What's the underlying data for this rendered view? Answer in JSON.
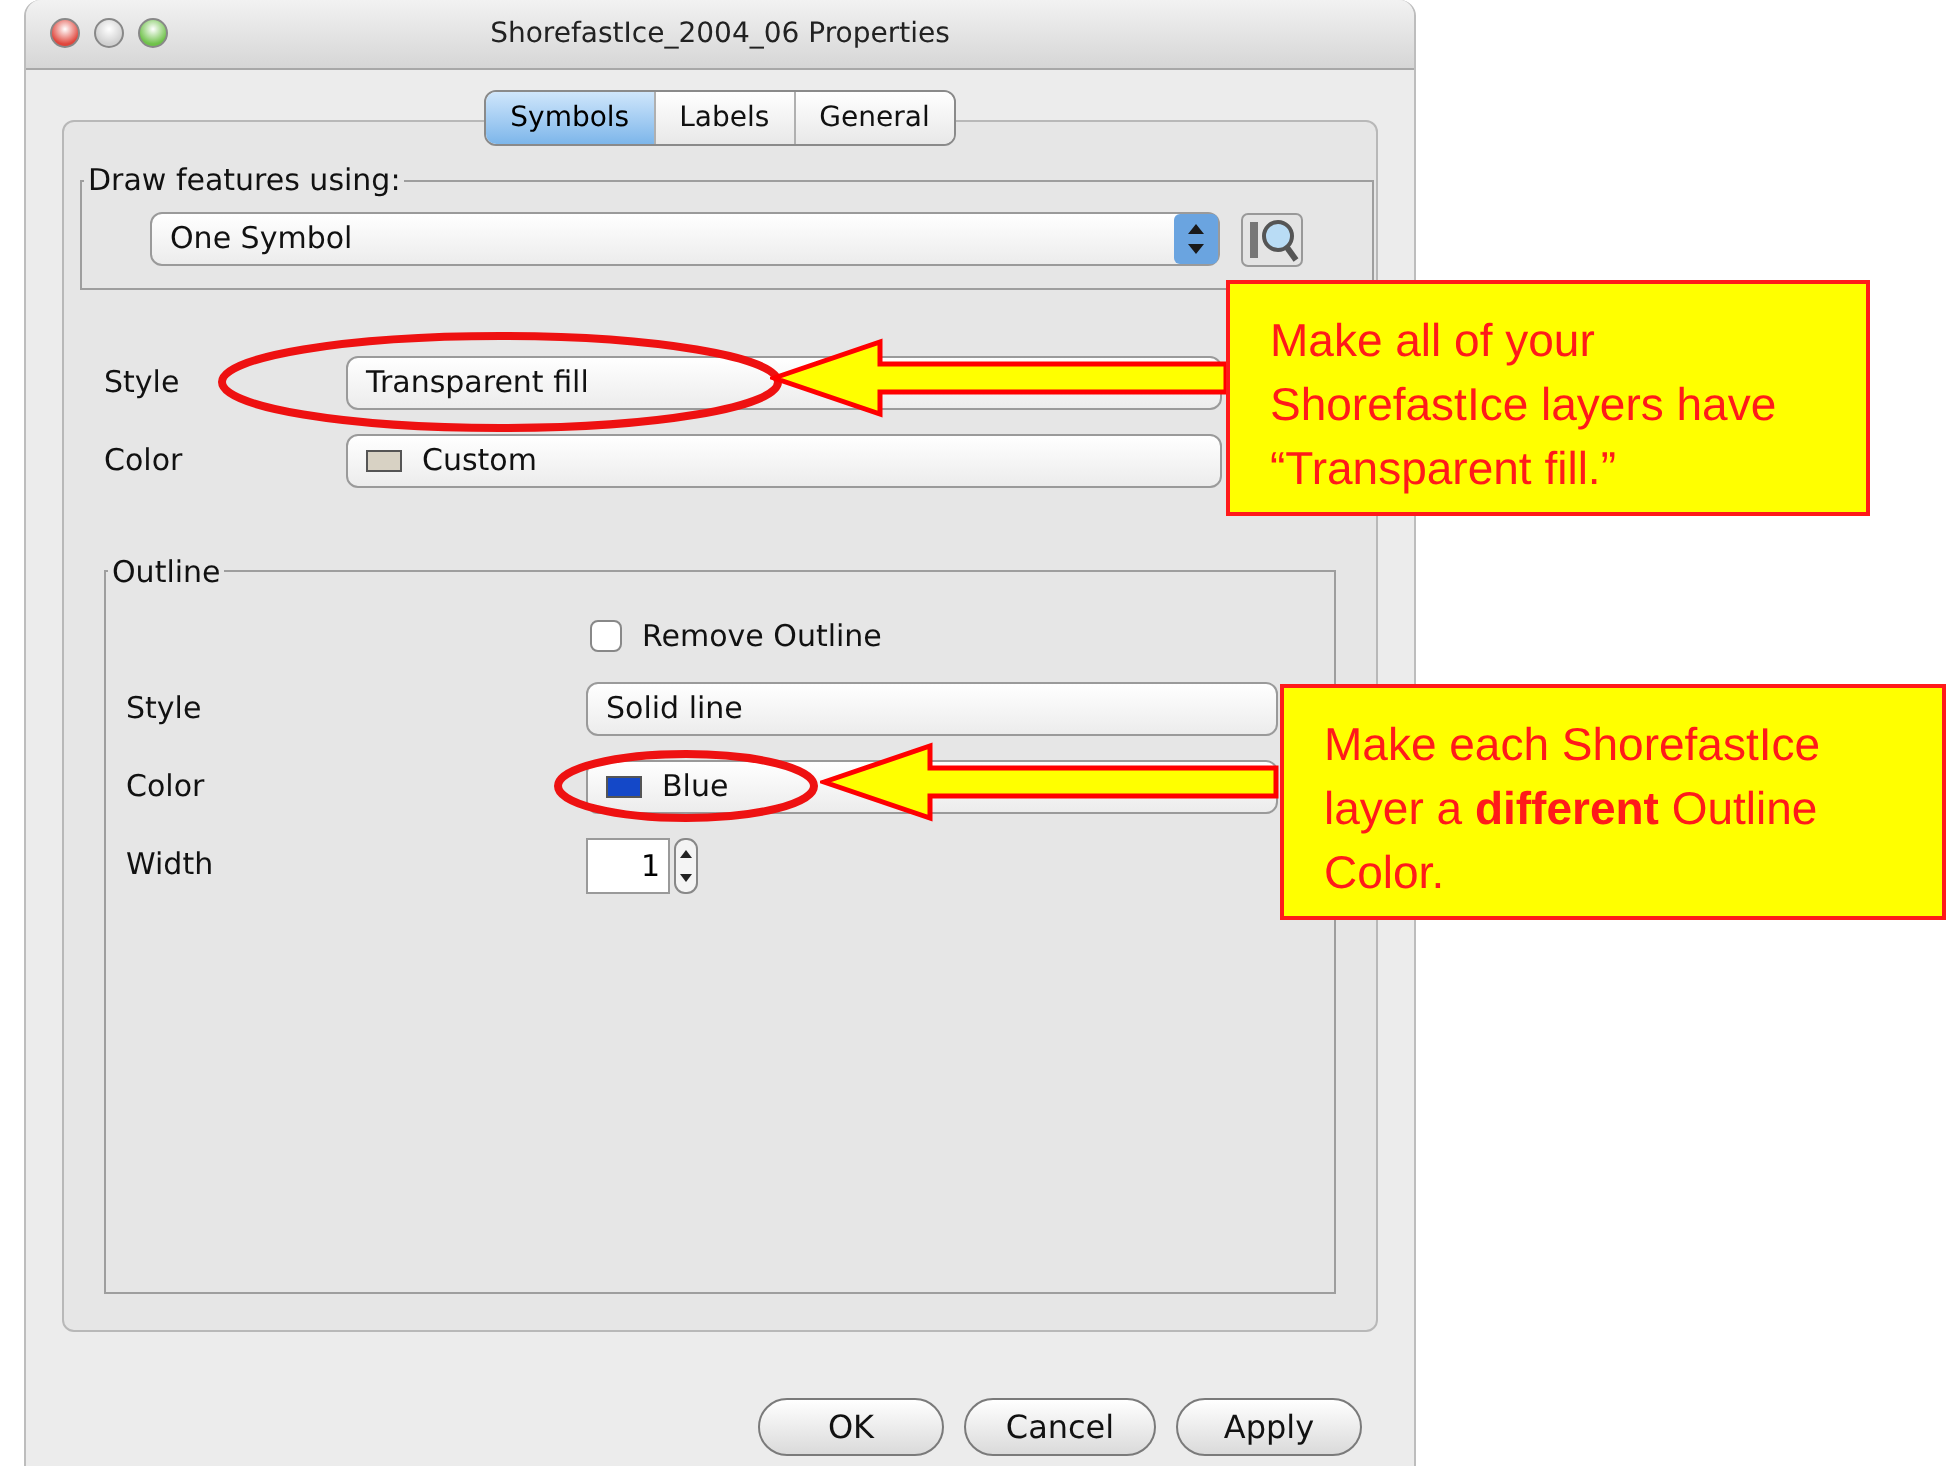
{
  "window": {
    "title": "ShorefastIce_2004_06 Properties"
  },
  "tabs": [
    {
      "label": "Symbols",
      "selected": true
    },
    {
      "label": "Labels",
      "selected": false
    },
    {
      "label": "General",
      "selected": false
    }
  ],
  "draw_features": {
    "label": "Draw features using:",
    "value": "One Symbol"
  },
  "fill": {
    "style_label": "Style",
    "style_value": "Transparent fill",
    "color_label": "Color",
    "color_value": "Custom"
  },
  "outline": {
    "label": "Outline",
    "remove_outline": {
      "label": "Remove Outline",
      "checked": false
    },
    "style_label": "Style",
    "style_value": "Solid line",
    "color_label": "Color",
    "color_value": "Blue",
    "width_label": "Width",
    "width_value": "1"
  },
  "buttons": [
    {
      "label": "OK"
    },
    {
      "label": "Cancel"
    },
    {
      "label": "Apply"
    }
  ],
  "callouts": [
    {
      "text": "Make all of your ShorefastIce layers have “Transparent fill.”"
    },
    {
      "text": "Make each ShorefastIce layer a **different** Outline Color."
    }
  ]
}
